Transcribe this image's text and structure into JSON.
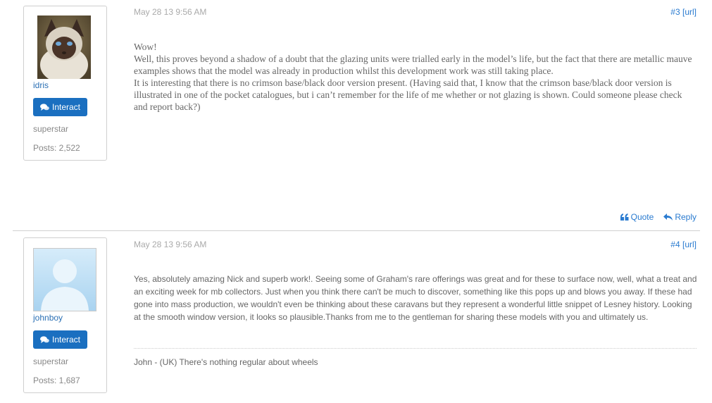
{
  "posts": [
    {
      "username": "idris",
      "interact_label": "Interact",
      "rank": "superstar",
      "posts_count": "Posts: 2,522",
      "date": "May 28 13 9:56 AM",
      "post_number": "#3",
      "url_label": "[url]",
      "body": [
        "Wow!",
        "Well, this proves beyond a shadow of a doubt that the glazing units were trialled early in the model’s life, but the fact that there are metallic mauve examples shows that the model was already in production whilst this development work was still taking place.",
        "It is interesting that there is no crimson base/black door version present. (Having said that, I know that the crimson base/black door version is illustrated in one of the pocket catalogues, but i can’t remember for the life of me whether or not glazing is shown. Could someone please check and report back?)"
      ],
      "quote_label": "Quote",
      "reply_label": "Reply"
    },
    {
      "username": "johnboy",
      "interact_label": "Interact",
      "rank": "superstar",
      "posts_count": "Posts: 1,687",
      "date": "May 28 13 9:56 AM",
      "post_number": "#4",
      "url_label": "[url]",
      "body": "Yes, absolutely amazing Nick and superb work!. Seeing some of Graham's rare offerings was great and for these to surface now, well, what a treat and an exciting week for mb collectors. Just when you think there can't be much to discover, something like this pops up and blows you away. If these had gone into mass production, we wouldn't even be thinking about these caravans but they represent a wonderful little snippet of Lesney history. Looking at the smooth window version, it looks so plausible.Thanks from me to the gentleman for sharing these models with you and ultimately us.",
      "signature": "John - (UK) There's nothing regular about wheels"
    }
  ],
  "icons": {
    "interact": "comments-icon",
    "quote": "quote-icon",
    "reply": "reply-icon"
  },
  "colors": {
    "button": "#1a6fc0",
    "link": "#2a7bd0",
    "username": "#2a6fb4"
  }
}
